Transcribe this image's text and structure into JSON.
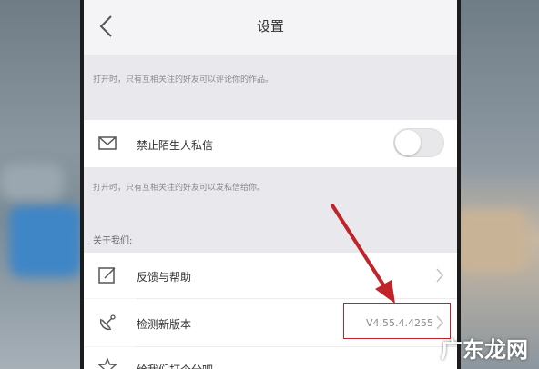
{
  "header": {
    "title": "设置",
    "back_icon": "chevron-left-icon"
  },
  "notes": {
    "comment_note": "打开时，只有互相关注的好友可以评论你的作品。",
    "message_note": "打开时，只有互相关注的好友可以发私信给你。"
  },
  "privacy": {
    "block_stranger_label": "禁止陌生人私信",
    "block_stranger_icon": "envelope-icon",
    "block_stranger_enabled": false
  },
  "about": {
    "section_title": "关于我们:",
    "items": [
      {
        "label": "反馈与帮助",
        "icon": "edit-icon"
      },
      {
        "label": "检测新版本",
        "icon": "satellite-icon",
        "value": "V4.55.4.4255"
      },
      {
        "label": "给我们打个分吧",
        "icon": "star-icon"
      }
    ]
  },
  "watermark": "广东龙网",
  "colors": {
    "highlight": "#c0242b",
    "background": "#f4f3f5"
  }
}
